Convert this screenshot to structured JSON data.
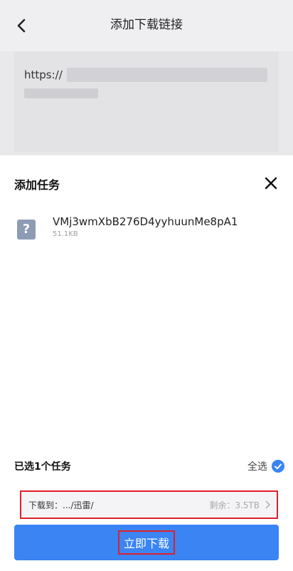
{
  "header": {
    "title": "添加下载链接"
  },
  "url_input": {
    "visible_text": "https://"
  },
  "sheet": {
    "title": "添加任务",
    "files": [
      {
        "name": "VMj3wmXbB276D4yyhuunMe8pA1",
        "size": "51.1KB",
        "icon": "unknown-file-icon",
        "icon_glyph": "?"
      }
    ],
    "selected_text": "已选1个任务",
    "select_all_label": "全选",
    "path_label": "下载到：",
    "path_value": ".../迅雷/",
    "space_label": "剩余：3.5TB",
    "download_label": "立即下载"
  },
  "colors": {
    "accent": "#3a84f4",
    "highlight_border": "#e0202a"
  }
}
